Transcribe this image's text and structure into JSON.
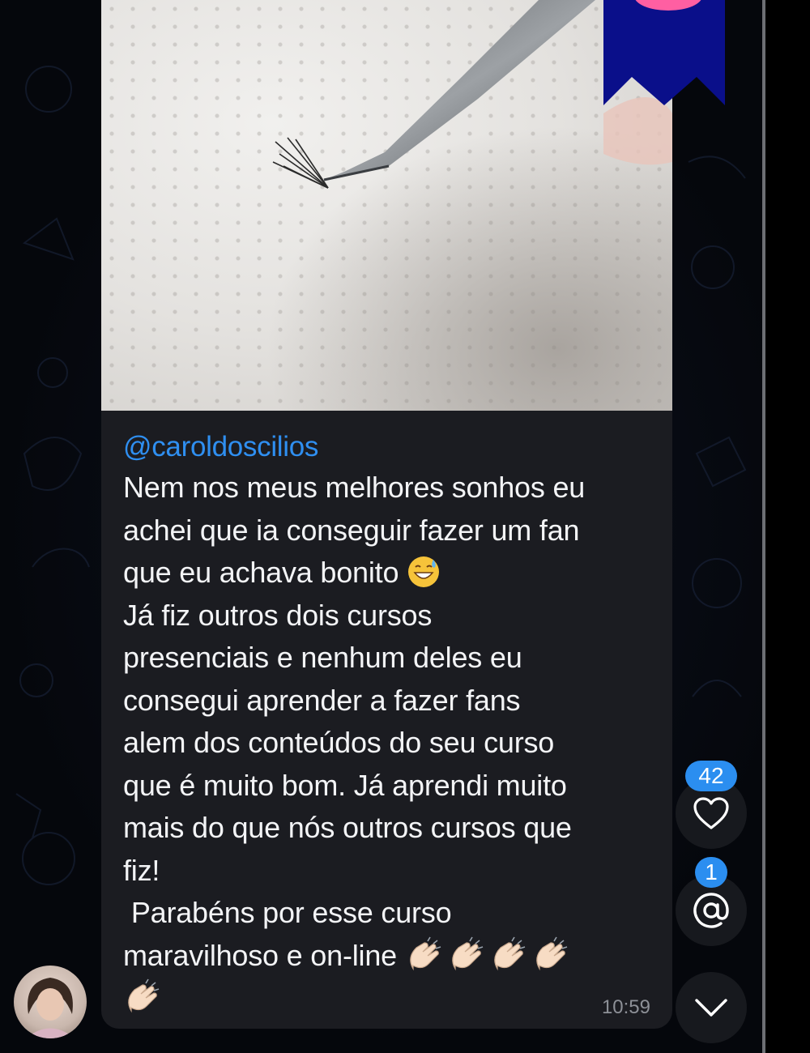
{
  "message": {
    "sender": "@caroldoscilios",
    "lines": [
      "Nem nos meus melhores sonhos eu",
      "achei que ia conseguir fazer um fan",
      "que eu achava bonito",
      "Já fiz outros dois cursos",
      "presenciais e nenhum deles eu",
      "consegui aprender a fazer fans",
      "alem dos conteúdos do seu curso",
      "que é muito bom. Já aprendi muito",
      "mais do que nós outros cursos que",
      "fiz!",
      " Parabéns por esse curso",
      "maravilhoso e on-line"
    ],
    "time": "10:59"
  },
  "side": {
    "likes_count": "42",
    "mentions_count": "1"
  },
  "colors": {
    "accent": "#2b8ef0",
    "bubble": "#1b1c21",
    "ribbon": "#0a0f8a"
  },
  "icons": {
    "like": "heart-icon",
    "mention": "at-icon",
    "scroll": "chevron-down-icon"
  }
}
